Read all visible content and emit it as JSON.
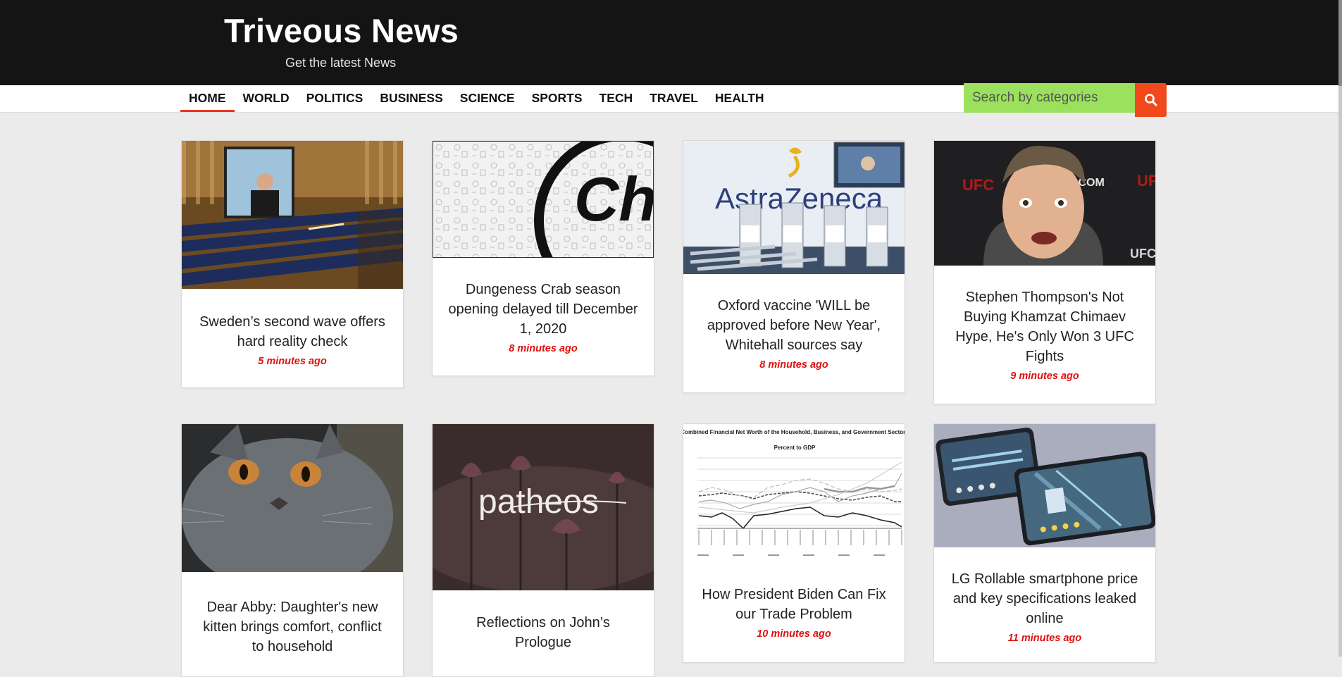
{
  "header": {
    "site_title": "Triveous News",
    "tagline": "Get the latest News"
  },
  "nav": {
    "items": [
      {
        "label": "HOME",
        "active": true
      },
      {
        "label": "WORLD"
      },
      {
        "label": "POLITICS"
      },
      {
        "label": "BUSINESS"
      },
      {
        "label": "SCIENCE"
      },
      {
        "label": "SPORTS"
      },
      {
        "label": "TECH"
      },
      {
        "label": "TRAVEL"
      },
      {
        "label": "HEALTH"
      }
    ]
  },
  "search": {
    "placeholder": "Search by categories",
    "button_icon": "search-icon"
  },
  "colors": {
    "accent": "#f04a1c",
    "search_bg": "#9be15d",
    "time_color": "#e01010",
    "header_bg": "#141414"
  },
  "articles": [
    {
      "title": "Sweden’s second wave offers hard reality check",
      "time": "5 minutes ago"
    },
    {
      "title": "Dungeness Crab season opening delayed till December 1, 2020",
      "time": "8 minutes ago"
    },
    {
      "title": "Oxford vaccine 'WILL be approved before New Year', Whitehall sources say",
      "time": "8 minutes ago"
    },
    {
      "title": "Stephen Thompson's Not Buying Khamzat Chimaev Hype, He's Only Won 3 UFC Fights",
      "time": "9 minutes ago"
    },
    {
      "title": "Dear Abby: Daughter's new kitten brings comfort, conflict to household",
      "time": ""
    },
    {
      "title": "Reflections on John’s Prologue",
      "time": ""
    },
    {
      "title": "How President Biden Can Fix our Trade Problem",
      "time": "10 minutes ago"
    },
    {
      "title": "LG Rollable smartphone price and key specifications leaked online",
      "time": "11 minutes ago"
    }
  ],
  "image_text": {
    "card2_logo": "Ch",
    "card3_brand": "AstraZeneca",
    "card4_ufc": "UFC",
    "card4_domain": ".COM",
    "card6_logo": "patheos",
    "card7_chart_title": "Combined Financial Net Worth of the Household, Business, and Government Sectors",
    "card7_chart_subtitle": "Percent to GDP"
  }
}
